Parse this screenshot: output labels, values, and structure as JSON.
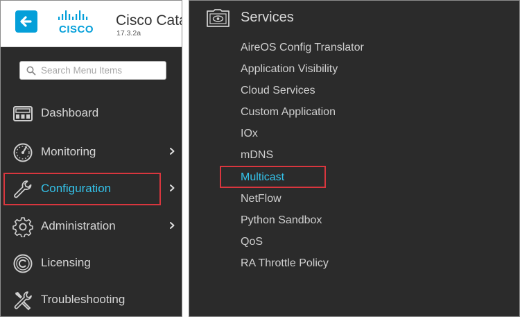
{
  "header": {
    "logo_text": "CISCO",
    "product_name": "Cisco Cata",
    "version": "17.3.2a"
  },
  "search": {
    "placeholder": "Search Menu Items"
  },
  "sidebar": {
    "items": [
      {
        "label": "Dashboard",
        "icon": "dashboard-icon",
        "has_chevron": false
      },
      {
        "label": "Monitoring",
        "icon": "gauge-icon",
        "has_chevron": true
      },
      {
        "label": "Configuration",
        "icon": "wrench-icon",
        "has_chevron": true,
        "active": true
      },
      {
        "label": "Administration",
        "icon": "gear-icon",
        "has_chevron": true
      },
      {
        "label": "Licensing",
        "icon": "license-icon",
        "has_chevron": false
      },
      {
        "label": "Troubleshooting",
        "icon": "tools-icon",
        "has_chevron": false
      }
    ]
  },
  "services": {
    "title": "Services",
    "icon": "services-icon",
    "items": [
      {
        "label": "AireOS Config Translator"
      },
      {
        "label": "Application Visibility"
      },
      {
        "label": "Cloud Services"
      },
      {
        "label": "Custom Application"
      },
      {
        "label": "IOx"
      },
      {
        "label": "mDNS"
      },
      {
        "label": "Multicast",
        "active": true
      },
      {
        "label": "NetFlow"
      },
      {
        "label": "Python Sandbox"
      },
      {
        "label": "QoS"
      },
      {
        "label": "RA Throttle Policy"
      }
    ]
  },
  "colors": {
    "panel_bg": "#2b2b2b",
    "accent": "#34c3ea",
    "cisco_blue": "#049fd9",
    "highlight": "#d9363e",
    "text": "#d6d6d6"
  }
}
